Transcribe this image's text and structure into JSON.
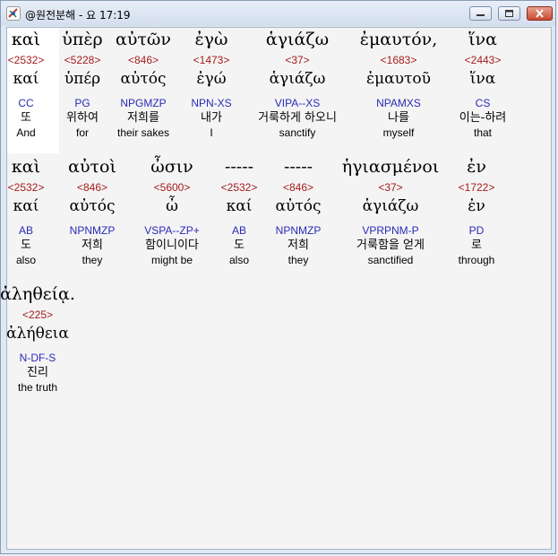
{
  "window": {
    "title": "@원전분해 - 요 17:19",
    "app_icon": "bible-app-icon",
    "buttons": [
      "minimize",
      "maximize",
      "close"
    ]
  },
  "rows": [
    {
      "words": [
        {
          "greek": "καὶ",
          "strong": "<2532>",
          "lemma": "καί",
          "parse": "CC",
          "korean": "또",
          "english": "And"
        },
        {
          "greek": "ὑπὲρ",
          "strong": "<5228>",
          "lemma": "ὑπέρ",
          "parse": "PG",
          "korean": "위하여",
          "english": "for"
        },
        {
          "greek": "αὐτῶν",
          "strong": "<846>",
          "lemma": "αὐτός",
          "parse": "NPGMZP",
          "korean": "저희를",
          "english": "their sakes"
        },
        {
          "greek": "ἐγὼ",
          "strong": "<1473>",
          "lemma": "ἐγώ",
          "parse": "NPN-XS",
          "korean": "내가",
          "english": "I"
        },
        {
          "greek": "ἁγιάζω",
          "strong": "<37>",
          "lemma": "ἁγιάζω",
          "parse": "VIPA--XS",
          "korean": "거룩하게 하오니",
          "english": "sanctify"
        },
        {
          "greek": "ἐμαυτόν,",
          "strong": "<1683>",
          "lemma": "ἐμαυτοῦ",
          "parse": "NPAMXS",
          "korean": "나를",
          "english": "myself"
        },
        {
          "greek": "ἵνα",
          "strong": "<2443>",
          "lemma": "ἵνα",
          "parse": "CS",
          "korean": "이는-하려",
          "english": "that"
        }
      ]
    },
    {
      "words": [
        {
          "greek": "καὶ",
          "strong": "<2532>",
          "lemma": "καί",
          "parse": "AB",
          "korean": "도",
          "english": "also"
        },
        {
          "greek": "αὐτοὶ",
          "strong": "<846>",
          "lemma": "αὐτός",
          "parse": "NPNMZP",
          "korean": "저희",
          "english": "they"
        },
        {
          "greek": "ὦσιν",
          "strong": "<5600>",
          "lemma": "ὦ",
          "parse": "VSPA--ZP+",
          "korean": "함이니이다",
          "english": "might be"
        },
        {
          "greek": "-----",
          "strong": "<2532>",
          "lemma": "καί",
          "parse": "AB",
          "korean": "도",
          "english": "also"
        },
        {
          "greek": "-----",
          "strong": "<846>",
          "lemma": "αὐτός",
          "parse": "NPNMZP",
          "korean": "저희",
          "english": "they"
        },
        {
          "greek": "ἡγιασμένοι",
          "strong": "<37>",
          "lemma": "ἁγιάζω",
          "parse": "VPRPNM-P",
          "korean": "거룩함을 얻게",
          "english": "sanctified"
        },
        {
          "greek": "ἐν",
          "strong": "<1722>",
          "lemma": "ἐν",
          "parse": "PD",
          "korean": "로",
          "english": "through"
        }
      ]
    },
    {
      "words": [
        {
          "greek": "ἀληθείᾳ.",
          "strong": "<225>",
          "lemma": "ἀλήθεια",
          "parse": "N-DF-S",
          "korean": "진리",
          "english": "the truth"
        }
      ]
    }
  ]
}
